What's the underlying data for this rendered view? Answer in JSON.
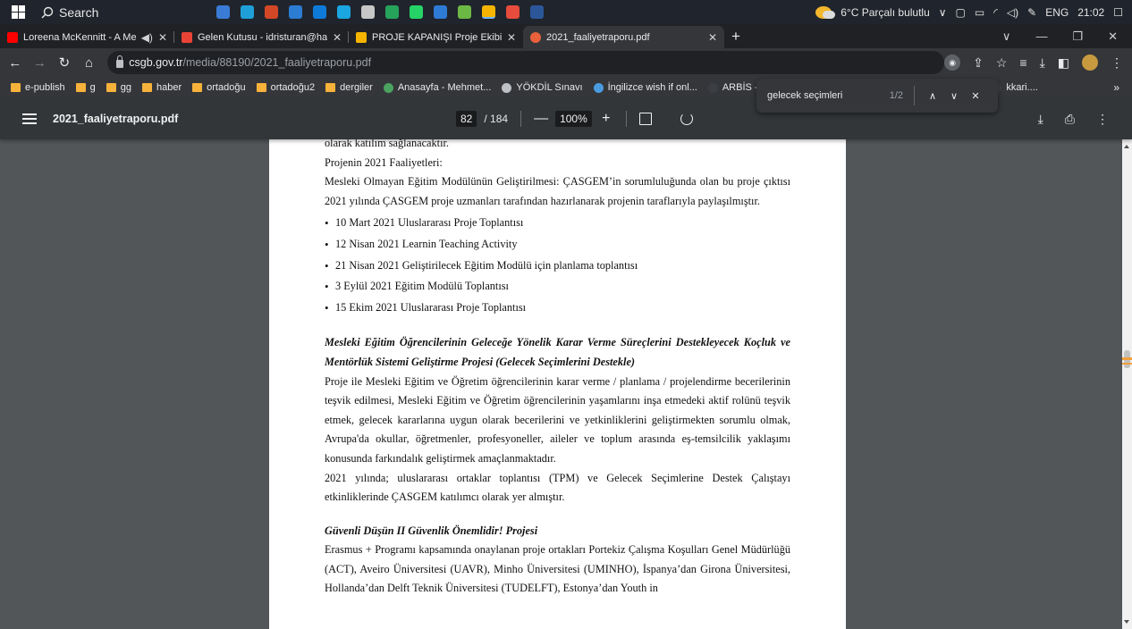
{
  "taskbar": {
    "search_label": "Search",
    "weather": "6°C Parçalı bulutlu",
    "language": "ENG",
    "time": "21:02",
    "app_colors": [
      "#3a7bd5",
      "#1f9fd8",
      "#d24726",
      "#2b7cd3",
      "#0f7bd8",
      "#1aa6e0",
      "#c7c7c7",
      "#26a35a",
      "#25d366",
      "#2e7bd6",
      "#6bb844",
      "#f4b400",
      "#e74c3c",
      "#2b579a"
    ]
  },
  "tabs": [
    {
      "title": "Loreena McKennitt - A Med",
      "color": "#ff0000",
      "audio": "◀)"
    },
    {
      "title": "Gelen Kutusu - idristuran@hakk",
      "color": "#ea4335"
    },
    {
      "title": "PROJE KAPANIŞI Proje Ekibi - Go",
      "color": "#f4b400"
    },
    {
      "title": "2021_faaliyetraporu.pdf",
      "color": "#e8613b"
    }
  ],
  "address": {
    "host": "csgb.gov.tr",
    "path": "/media/88190/2021_faaliyetraporu.pdf"
  },
  "bookmarks": [
    {
      "label": "e-publish",
      "kind": "folder"
    },
    {
      "label": "g",
      "kind": "folder"
    },
    {
      "label": "gg",
      "kind": "folder"
    },
    {
      "label": "haber",
      "kind": "folder"
    },
    {
      "label": "ortadoğu",
      "kind": "folder"
    },
    {
      "label": "ortadoğu2",
      "kind": "folder"
    },
    {
      "label": "dergiler",
      "kind": "folder"
    },
    {
      "label": "Anasayfa - Mehmet...",
      "kind": "site",
      "color": "#4aa35f"
    },
    {
      "label": "YÖKDİL Sınavı",
      "kind": "site",
      "color": "#bdc1c6"
    },
    {
      "label": "İngilizce wish if onl...",
      "kind": "site",
      "color": "#4b9be0"
    },
    {
      "label": "ARBİS - A",
      "kind": "site",
      "color": "#3b3f44"
    },
    {
      "label": "kkari....",
      "kind": "site",
      "color": "#3b3f44"
    }
  ],
  "find": {
    "query": "gelecek seçimleri",
    "count": "1/2"
  },
  "pdf": {
    "title": "2021_faaliyetraporu.pdf",
    "page": "82",
    "total": "/ 184",
    "zoom": "100%"
  },
  "doc": {
    "line0": "olarak katılım sağlanacaktır.",
    "line1": "Projenin 2021 Faaliyetleri:",
    "para1": "Mesleki Olmayan Eğitim Modülünün Geliştirilmesi: ÇASGEM’in sorumluluğunda olan bu proje çıktısı 2021 yılında ÇASGEM proje uzmanları tarafından hazırlanarak projenin taraflarıyla paylaşılmıştır.",
    "bullets": [
      "10 Mart 2021 Uluslararası Proje Toplantısı",
      "12 Nisan 2021 Learnin Teaching Activity",
      "21 Nisan 2021 Geliştirilecek Eğitim Modülü için planlama toplantısı",
      "3 Eylül 2021 Eğitim Modülü Toplantısı",
      "15 Ekim 2021 Uluslararası Proje Toplantısı"
    ],
    "heading2": "Mesleki Eğitim Öğrencilerinin Geleceğe Yönelik Karar Verme Süreçlerini  Destekleyecek Koçluk ve Mentörlük Sistemi Geliştirme Projesi  (Gelecek Seçimlerini Destekle)",
    "para2": "Proje ile Mesleki Eğitim ve Öğretim öğrencilerinin karar verme / planlama / projelendirme becerilerinin teşvik edilmesi, Mesleki Eğitim ve Öğretim öğrencilerinin yaşamlarını inşa etmedeki aktif rolünü teşvik etmek, gelecek kararlarına uygun olarak becerilerini ve yetkinliklerini geliştirmekten sorumlu olmak, Avrupa'da okullar, öğretmenler, profesyoneller, aileler ve toplum arasında eş-temsilcilik yaklaşımı konusunda farkındalık geliştirmek amaçlanmaktadır.",
    "para3": "2021 yılında; uluslararası ortaklar toplantısı (TPM) ve Gelecek Seçimlerine Destek Çalıştayı etkinliklerinde ÇASGEM katılımcı olarak yer almıştır.",
    "heading3": "Güvenli Düşün II Güvenlik Önemlidir! Projesi",
    "para4": "Erasmus + Programı kapsamında onaylanan proje ortakları Portekiz Çalışma Koşulları Genel Müdürlüğü (ACT), Aveiro Üniversitesi (UAVR), Minho Üniversitesi (UMINHO), İspanya’dan Girona Üniversitesi, Hollanda’dan Delft Teknik Üniversitesi (TUDELFT), Estonya’dan Youth in"
  }
}
